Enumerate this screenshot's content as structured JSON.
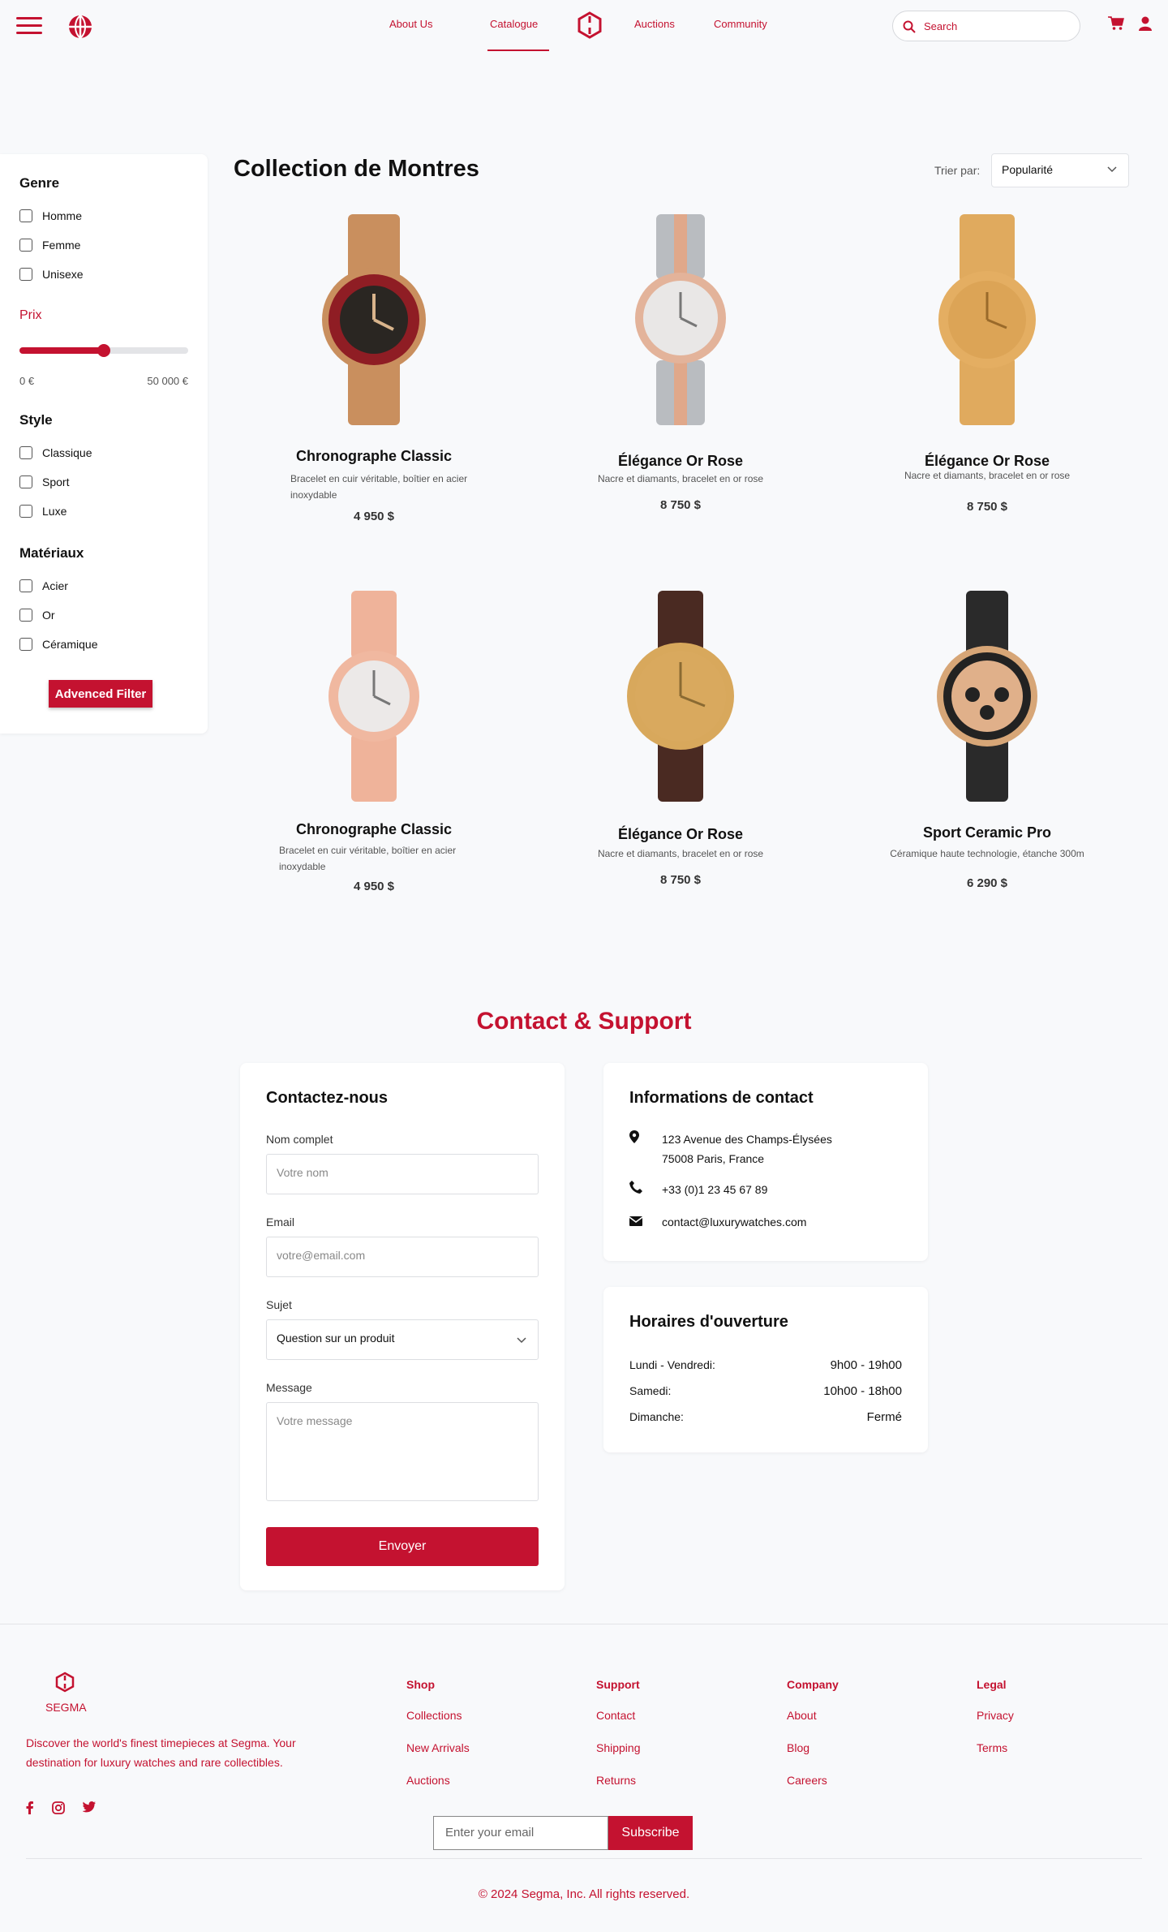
{
  "header": {
    "nav": [
      "About Us",
      "Catalogue",
      "Auctions",
      "Community"
    ],
    "search_placeholder": "Search"
  },
  "sidebar": {
    "genre_title": "Genre",
    "genre_options": [
      "Homme",
      "Femme",
      "Unisexe"
    ],
    "price_title": "Prix",
    "price_min": "0 €",
    "price_max": "50 000 €",
    "price_slider_value": 0.5,
    "style_title": "Style",
    "style_options": [
      "Classique",
      "Sport",
      "Luxe"
    ],
    "material_title": "Matériaux",
    "material_options": [
      "Acier",
      "Or",
      "Céramique"
    ],
    "advanced_filter": "Advenced Filter"
  },
  "catalog": {
    "title": "Collection de Montres",
    "sort_label": "Trier par:",
    "sort_value": "Popularité",
    "products": [
      {
        "name": "Chronographe Classic",
        "desc": "Bracelet en cuir véritable, boîtier en acier inoxydable",
        "price": "4 950 $"
      },
      {
        "name": "Élégance Or Rose",
        "desc": "Nacre et diamants, bracelet en or rose",
        "price": "8 750 $"
      },
      {
        "name": "Élégance Or Rose",
        "desc": "Nacre et diamants, bracelet en or rose",
        "price": "8 750 $"
      },
      {
        "name": "Chronographe Classic",
        "desc": "Bracelet en cuir véritable, boîtier en acier inoxydable",
        "price": "4 950 $"
      },
      {
        "name": "Élégance Or Rose",
        "desc": "Nacre et diamants, bracelet en or rose",
        "price": "8 750 $"
      },
      {
        "name": "Sport Ceramic Pro",
        "desc": "Céramique haute technologie, étanche 300m",
        "price": "6 290 $"
      }
    ]
  },
  "contact": {
    "section_title": "Contact & Support",
    "form": {
      "title": "Contactez-nous",
      "name_label": "Nom complet",
      "name_placeholder": "Votre nom",
      "email_label": "Email",
      "email_placeholder": "votre@email.com",
      "subject_label": "Sujet",
      "subject_value": "Question sur un produit",
      "message_label": "Message",
      "message_placeholder": "Votre message",
      "submit": "Envoyer"
    },
    "info": {
      "title": "Informations de contact",
      "address_line1": "123 Avenue des Champs-Élysées",
      "address_line2": "75008 Paris, France",
      "phone": "+33 (0)1 23 45 67 89",
      "email": "contact@luxurywatches.com"
    },
    "hours": {
      "title": "Horaires d'ouverture",
      "rows": [
        {
          "day": "Lundi - Vendredi:",
          "time": "9h00 - 19h00"
        },
        {
          "day": "Samedi:",
          "time": "10h00 - 18h00"
        },
        {
          "day": "Dimanche:",
          "time": "Fermé"
        }
      ]
    }
  },
  "footer": {
    "brand": "SEGMA",
    "tagline": "Discover the world's finest timepieces at Segma. Your destination for luxury watches and rare collectibles.",
    "columns": [
      {
        "title": "Shop",
        "links": [
          "Collections",
          "New Arrivals",
          "Auctions"
        ]
      },
      {
        "title": "Support",
        "links": [
          "Contact",
          "Shipping",
          "Returns"
        ]
      },
      {
        "title": "Company",
        "links": [
          "About",
          "Blog",
          "Careers"
        ]
      },
      {
        "title": "Legal",
        "links": [
          "Privacy",
          "Terms"
        ]
      }
    ],
    "email_placeholder": "Enter your email",
    "subscribe": "Subscribe",
    "copyright": "© 2024 Segma, Inc. All rights reserved."
  },
  "colors": {
    "accent": "#c41230",
    "background": "#f8f9fb"
  }
}
